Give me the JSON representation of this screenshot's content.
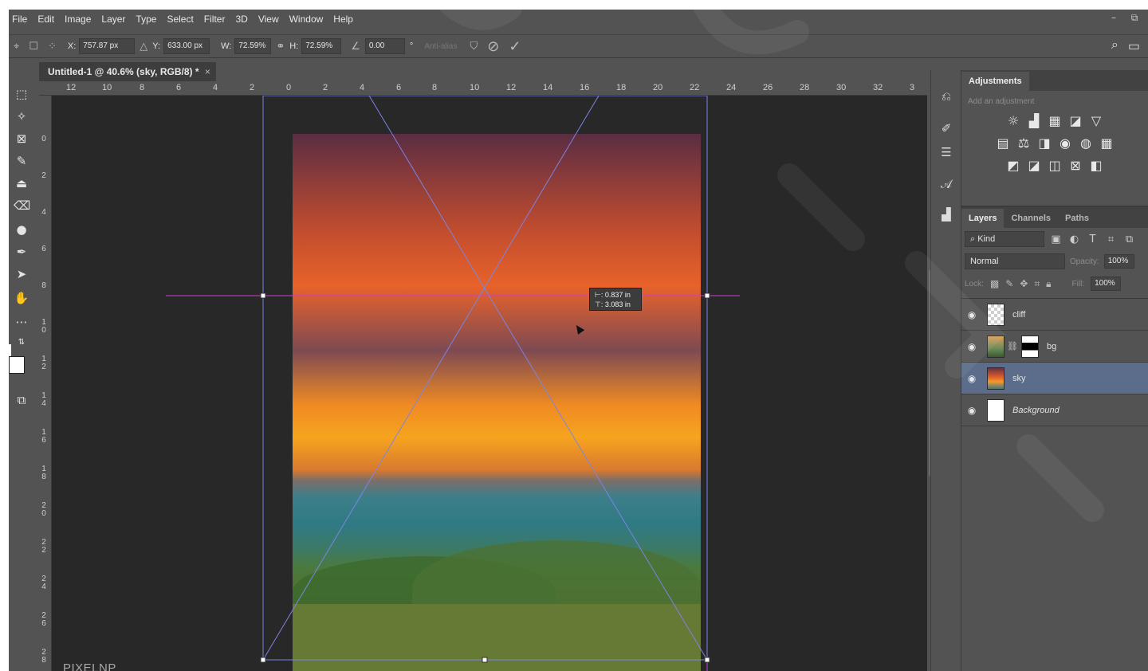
{
  "menu": [
    "File",
    "Edit",
    "Image",
    "Layer",
    "Type",
    "Select",
    "Filter",
    "3D",
    "View",
    "Window",
    "Help"
  ],
  "window_controls": {
    "minimize": "–",
    "restore": "⧉"
  },
  "options": {
    "x_label": "X:",
    "x_value": "757.87 px",
    "y_label": "Y:",
    "y_value": "633.00 px",
    "w_label": "W:",
    "w_value": "72.59%",
    "h_label": "H:",
    "h_value": "72.59%",
    "angle_value": "0.00",
    "degree": "°",
    "antialias": "Anti-alias",
    "cancel_icon": "⊘",
    "commit_icon": "✓",
    "search_icon": "⌕",
    "workspace_icon": "▭"
  },
  "document": {
    "tab_title": "Untitled-1 @ 40.6% (sky, RGB/8) *",
    "close": "×"
  },
  "ruler_top": [
    "12",
    "10",
    "8",
    "6",
    "4",
    "2",
    "0",
    "2",
    "4",
    "6",
    "8",
    "10",
    "12",
    "14",
    "16",
    "18",
    "20",
    "22",
    "24",
    "26",
    "28",
    "30",
    "32",
    "3"
  ],
  "ruler_left": [
    "0",
    "2",
    "4",
    "6",
    "8",
    "1\n0",
    "1\n2",
    "1\n4",
    "1\n6",
    "1\n8",
    "2\n0",
    "2\n2",
    "2\n4",
    "2\n6",
    "2\n8"
  ],
  "measure": {
    "line1": "⊢: 0.837 in",
    "line2": "⊤: 3.083 in"
  },
  "brand_label": "PIXELNP",
  "adjustments": {
    "tab": "Adjustments",
    "hint": "Add an adjustment",
    "row1": [
      "☼",
      "▟",
      "▦",
      "◪",
      "▽"
    ],
    "row2": [
      "▤",
      "⚖",
      "◨",
      "◉",
      "◍",
      "▦"
    ],
    "row3": [
      "◩",
      "◪",
      "◫",
      "⊠",
      "◧"
    ]
  },
  "layers_panel": {
    "tabs": [
      "Layers",
      "Channels",
      "Paths"
    ],
    "kind": "Kind",
    "blend_mode": "Normal",
    "opacity_label": "Opacity:",
    "opacity_value": "100%",
    "lock_label": "Lock:",
    "fill_label": "Fill:",
    "fill_value": "100%",
    "layers": [
      {
        "name": "cliff",
        "visible": true,
        "selected": false
      },
      {
        "name": "bg",
        "visible": true,
        "selected": false
      },
      {
        "name": "sky",
        "visible": true,
        "selected": true
      },
      {
        "name": "Background",
        "visible": true,
        "selected": false
      }
    ]
  },
  "colors": {
    "selection": "#5b6d8a",
    "guide": "#d13bd1",
    "transform_line": "#7b84e6"
  }
}
